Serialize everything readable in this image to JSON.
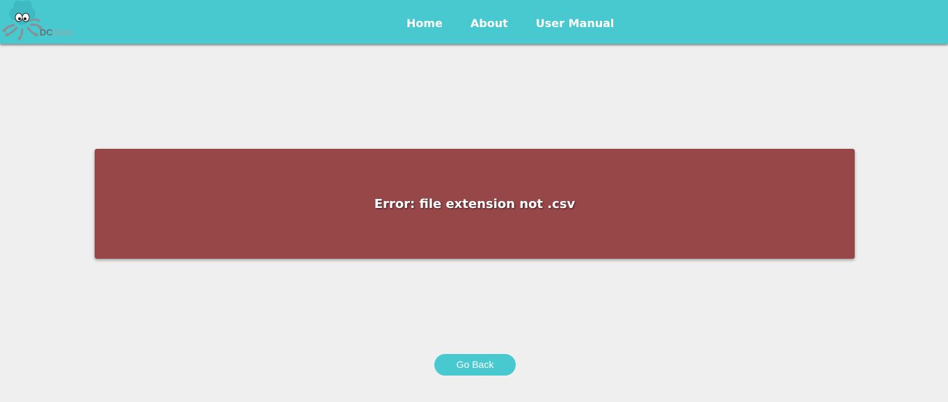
{
  "header": {
    "logo": {
      "icon": "octopus-mascot-icon",
      "text_bold": "DC",
      "text_rest": "Stats"
    },
    "nav": [
      {
        "label": "Home"
      },
      {
        "label": "About"
      },
      {
        "label": "User Manual"
      }
    ]
  },
  "main": {
    "error_message": "Error: file extension not .csv",
    "go_back_label": "Go Back"
  },
  "colors": {
    "navbar": "#48c9d0",
    "error_background": "#984749",
    "page_background": "#efefef",
    "button": "#48c9d0"
  }
}
